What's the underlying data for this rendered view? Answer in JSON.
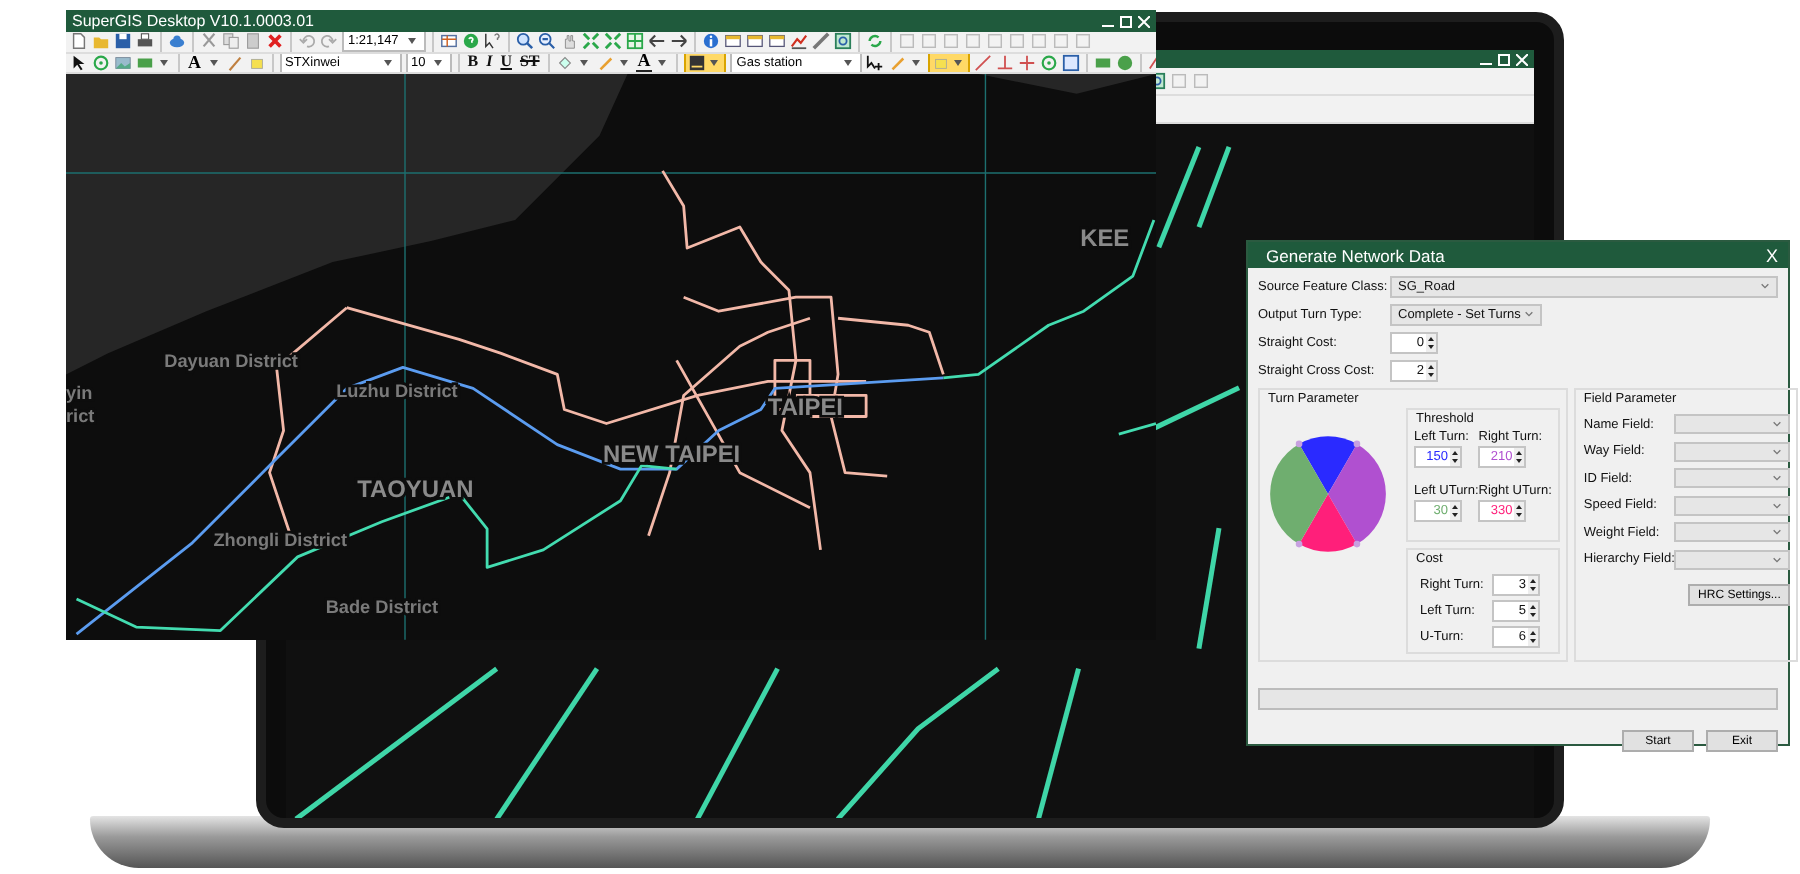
{
  "app_window": {
    "title": "SuperGIS Desktop V10.1.0003.01",
    "toolbar": {
      "scale": "1:21,147",
      "text_tool": "A",
      "font": "STXinwei",
      "font_size": "10",
      "format_buttons": [
        {
          "label": "B",
          "kind": "bold"
        },
        {
          "label": "I",
          "kind": "italic"
        },
        {
          "label": "U",
          "kind": "underline"
        },
        {
          "label": "ST",
          "kind": "strike"
        }
      ],
      "font_color": "A",
      "layer": "Gas station"
    },
    "map": {
      "labels": [
        "yin",
        "rict",
        "Dayuan District",
        "Luzhu District",
        "TAOYUAN",
        "NEW TAIPEI",
        "TAIPEI",
        "KEE",
        "Zhongli District",
        "Bade District"
      ]
    }
  },
  "dialog": {
    "title": "Generate Network Data",
    "close": "X",
    "fields": [
      {
        "label": "Source Feature Class:",
        "kind": "dropdown-wide",
        "value": "SG_Road"
      },
      {
        "label": "Output Turn Type:",
        "kind": "dropdown",
        "value": "Complete - Set Turns"
      },
      {
        "label": "Straight Cost:",
        "kind": "spinner",
        "value": "0"
      },
      {
        "label": "Straight Cross Cost:",
        "kind": "spinner",
        "value": "2"
      }
    ],
    "turn_parameter": {
      "title": "Turn Parameter",
      "threshold": {
        "title": "Threshold",
        "items": [
          {
            "label": "Left Turn:",
            "value": "150",
            "color": "#2a2aff"
          },
          {
            "label": "Right Turn:",
            "value": "210",
            "color": "#b050d0"
          },
          {
            "label": "Left UTurn:",
            "value": "30",
            "color": "#6fae6f"
          },
          {
            "label": "Right UTurn:",
            "value": "330",
            "color": "#ff1f7a"
          }
        ]
      },
      "cost": {
        "title": "Cost",
        "items": [
          {
            "label": "Right Turn:",
            "value": "3"
          },
          {
            "label": "Left Turn:",
            "value": "5"
          },
          {
            "label": "U-Turn:",
            "value": "6"
          }
        ]
      }
    },
    "field_parameter": {
      "title": "Field Parameter",
      "fields": [
        {
          "label": "Name Field:"
        },
        {
          "label": "Way Field:"
        },
        {
          "label": "ID Field:"
        },
        {
          "label": "Speed Field:"
        },
        {
          "label": "Weight Field:"
        },
        {
          "label": "Hierarchy Field:"
        }
      ],
      "button": "HRC Settings..."
    },
    "progress": {
      "level": 0
    },
    "buttons": [
      "Start",
      "Exit"
    ]
  }
}
